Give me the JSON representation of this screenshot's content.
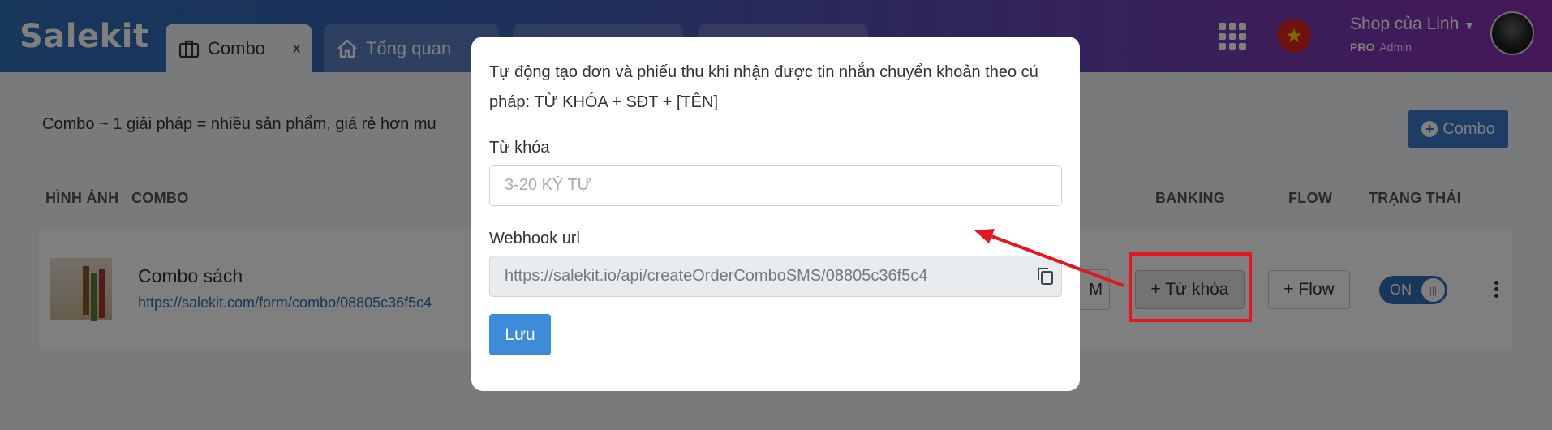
{
  "header": {
    "logo": "Salekit",
    "tabs": [
      {
        "label": "Combo",
        "close": "x",
        "icon": "briefcase-icon"
      },
      {
        "label": "Tổng quan",
        "icon": "home-icon"
      }
    ],
    "shop_name": "Shop của Linh",
    "plan": "PRO",
    "role": "Admin"
  },
  "page": {
    "description": "Combo ~ 1 giải pháp = nhiều sản phẩm, giá rẻ hơn mu",
    "add_button": "Combo",
    "columns": {
      "image": "HÌNH ẢNH",
      "combo": "COMBO",
      "banking": "BANKING",
      "flow": "FLOW",
      "status": "TRẠNG THÁI"
    },
    "row": {
      "name": "Combo sách",
      "link": "https://salekit.com/form/combo/08805c36f5c4",
      "partial_button": "M",
      "keyword_button": "+ Từ khóa",
      "flow_button": "+ Flow",
      "toggle": "ON"
    }
  },
  "modal": {
    "description": "Tự động tạo đơn và phiếu thu khi nhận được tin nhắn chuyển khoản theo cú pháp: TỪ KHÓA + SĐT + [TÊN]",
    "keyword_label": "Từ khóa",
    "keyword_placeholder": "3-20 KÝ TỰ",
    "webhook_label": "Webhook url",
    "webhook_value": "https://salekit.io/api/createOrderComboSMS/08805c36f5c4",
    "save_button": "Lưu"
  },
  "colors": {
    "accent": "#3a7bc8",
    "highlight": "#e5161d"
  }
}
